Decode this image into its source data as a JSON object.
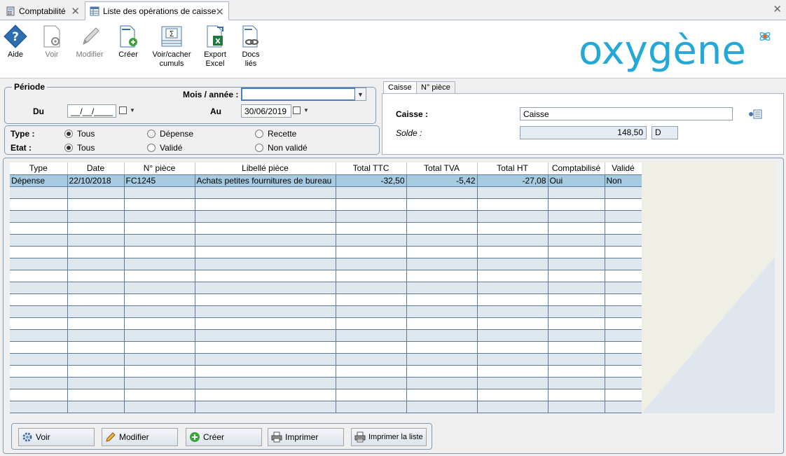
{
  "tabs": [
    {
      "label": "Comptabilité"
    },
    {
      "label": "Liste des opérations de caisse"
    }
  ],
  "toolbar": {
    "aide": "Aide",
    "voir": "Voir",
    "modifier": "Modifier",
    "creer": "Créer",
    "cumuls_1": "Voir/cacher",
    "cumuls_2": "cumuls",
    "export_1": "Export",
    "export_2": "Excel",
    "docs_1": "Docs",
    "docs_2": "liés"
  },
  "logo": {
    "text": "oxygène",
    "color": "#23a8d8"
  },
  "periode": {
    "legend": "Période",
    "mois_label": "Mois / année :",
    "mois_value": "",
    "du_label": "Du",
    "du_value": "__/__/____",
    "au_label": "Au",
    "au_value": "30/06/2019"
  },
  "filters": {
    "type_label": "Type :",
    "type_options": [
      "Tous",
      "Dépense",
      "Recette"
    ],
    "type_selected": "Tous",
    "etat_label": "Etat :",
    "etat_options": [
      "Tous",
      "Validé",
      "Non validé"
    ],
    "etat_selected": "Tous"
  },
  "right_tabs": [
    "Caisse",
    "N° pièce"
  ],
  "caisse": {
    "caisse_label": "Caisse :",
    "caisse_value": "Caisse",
    "solde_label": "Solde :",
    "solde_value": "148,50",
    "solde_sign": "D"
  },
  "table": {
    "columns": [
      "Type",
      "Date",
      "N° pièce",
      "Libellé pièce",
      "Total TTC",
      "Total TVA",
      "Total HT",
      "Comptabilisé",
      "Validé"
    ],
    "rows": [
      [
        "Dépense",
        "22/10/2018",
        "FC1245",
        "Achats petites fournitures de bureau",
        "-32,50",
        "-5,42",
        "-27,08",
        "Oui",
        "Non"
      ]
    ]
  },
  "buttons": {
    "voir": "Voir",
    "modifier": "Modifier",
    "creer": "Créer",
    "imprimer": "Imprimer",
    "imprimer_liste": "Imprimer la liste"
  }
}
